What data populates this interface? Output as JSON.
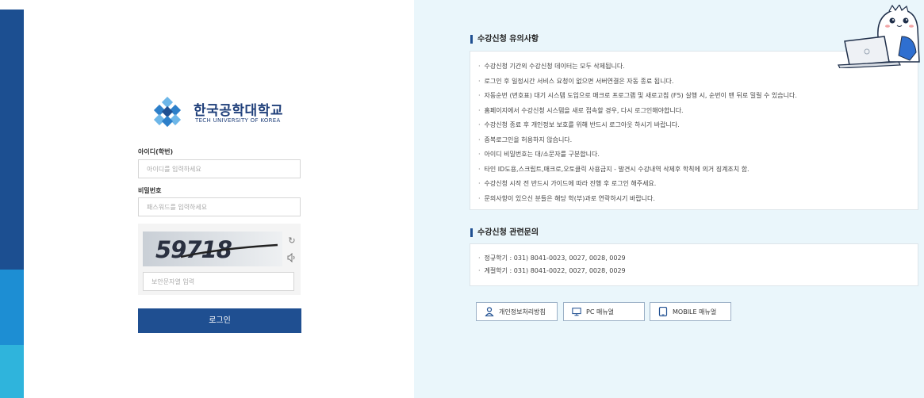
{
  "logo": {
    "name": "한국공학대학교",
    "subtitle": "TECH UNIVERSITY OF KOREA"
  },
  "login": {
    "id_label": "아이디(학번)",
    "id_placeholder": "아이디를 입력하세요",
    "pw_label": "비밀번호",
    "pw_placeholder": "패스워드를 입력하세요",
    "captcha_text": "59718",
    "captcha_placeholder": "보안문자열 입력",
    "login_button": "로그인"
  },
  "notice": {
    "title": "수강신청 유의사항",
    "items": [
      "수강신청 기간외 수강신청 데이터는 모두 삭제됩니다.",
      "로그인 후 일정시간 서비스 요청이 없으면 서버연결은 자동 종료 됩니다.",
      "자동순번 (번호표) 대기 시스템 도입으로 매크로 프로그램 및 새로고침 (F5) 실행 시, 순번이 맨 뒤로 밀릴 수 있습니다.",
      "홈페이지에서 수강신청 시스템을 새로 접속할 경우, 다시 로그인해야합니다.",
      "수강신청 종료 후 개인정보 보호를 위해 반드시 로그아웃 하시기 바랍니다.",
      "중복로그인을 허용하지 않습니다.",
      "아이디 비밀번호는 대/소문자를 구분합니다.",
      "타인 ID도용,스크립트,매크로,오토클릭 사용금지 - 발견시 수강내역 삭제후 학칙에 의거 징계조치 함.",
      "수강신청 시작 전 반드시 가이드에 따라 진행 후 로그인 해주세요.",
      "문의사항이 있으신 분들은 해당 학(부)과로 연락하시기 바랍니다."
    ]
  },
  "contact": {
    "title": "수강신청 관련문의",
    "items": [
      "정규학기 : 031) 8041-0023, 0027, 0028, 0029",
      "계절학기 : 031) 8041-0022, 0027, 0028, 0029"
    ]
  },
  "buttons": {
    "privacy": "개인정보처리방침",
    "pc_manual": "PC 매뉴얼",
    "mobile_manual": "MOBILE 매뉴얼"
  },
  "icons": {
    "logo": "university-logo-icon",
    "refresh": "refresh-icon",
    "audio": "speaker-icon",
    "privacy": "person-icon",
    "pc": "monitor-icon",
    "mobile": "tablet-icon",
    "mascot": "dinosaur-mascot-icon"
  },
  "colors": {
    "primary": "#1f4f91",
    "strip_dark": "#1c4f91",
    "strip_mid": "#1d8ed3",
    "strip_light": "#2fb4dc",
    "right_bg": "#eaf6fb"
  }
}
